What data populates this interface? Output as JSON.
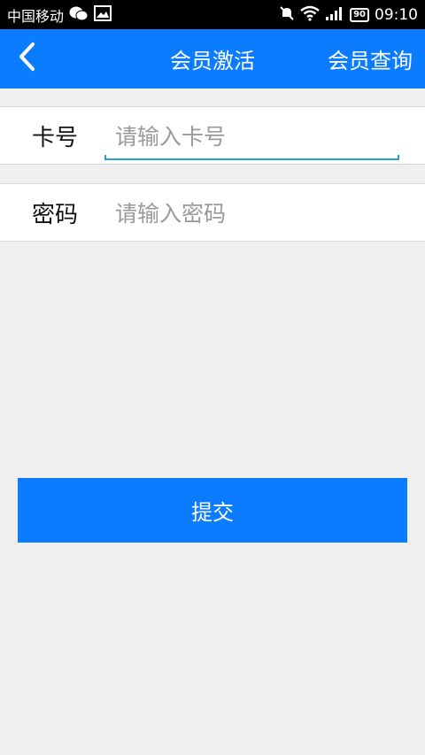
{
  "status_bar": {
    "carrier": "中国移动",
    "battery": "90",
    "time": "09:10"
  },
  "header": {
    "title": "会员激活",
    "right_action": "会员查询",
    "back_icon": "chevron-left-icon"
  },
  "form": {
    "card_label": "卡号",
    "card_placeholder": "请输入卡号",
    "password_label": "密码",
    "password_placeholder": "请输入密码"
  },
  "submit_label": "提交",
  "colors": {
    "primary": "#0b7cff",
    "background": "#efefef",
    "focus_underline": "#2a9fd8"
  }
}
